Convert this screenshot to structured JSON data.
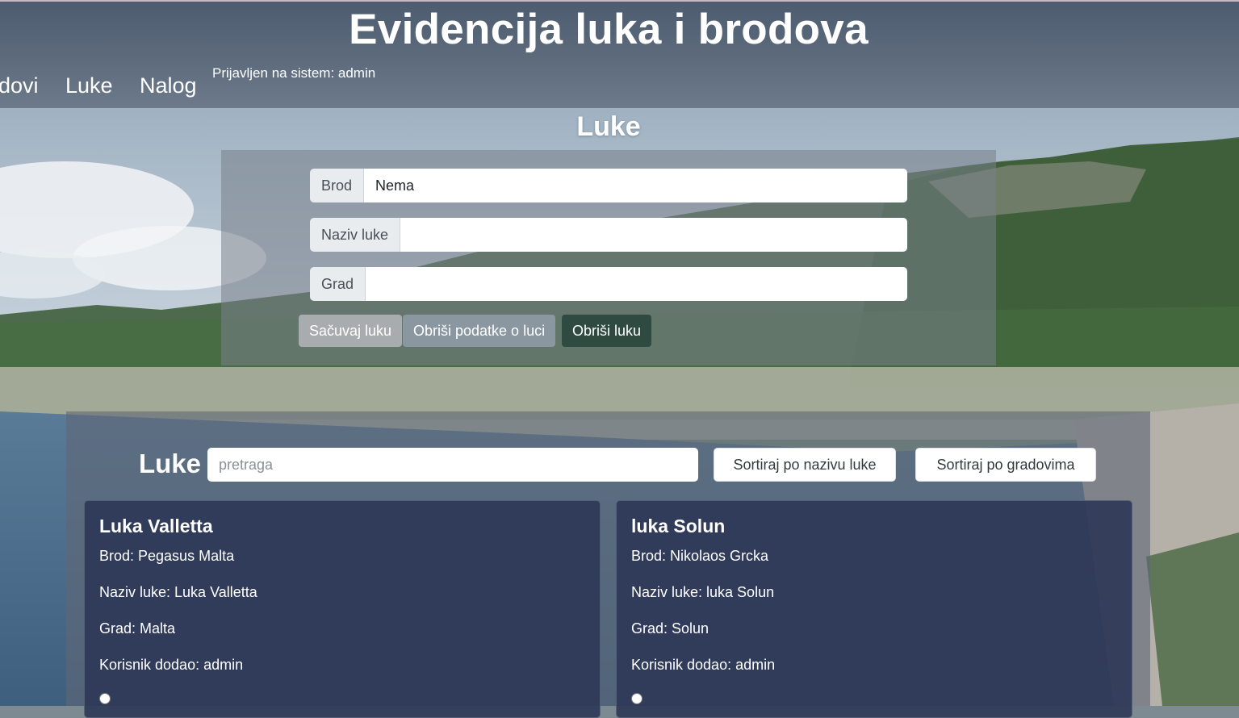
{
  "header": {
    "title": "Evidencija luka i brodova",
    "nav": [
      "dovi",
      "Luke",
      "Nalog"
    ],
    "login_status": "Prijavljen na sistem: admin"
  },
  "form": {
    "section_title": "Luke",
    "fields": [
      {
        "label": "Brod",
        "value": "Nema"
      },
      {
        "label": "Naziv luke",
        "value": ""
      },
      {
        "label": "Grad",
        "value": ""
      }
    ],
    "buttons": {
      "save": "Sačuvaj luku",
      "clear": "Obriši podatke o luci",
      "delete": "Obriši luku"
    }
  },
  "list": {
    "title": "Luke",
    "search_placeholder": "pretraga",
    "sort_by_name": "Sortiraj po nazivu luke",
    "sort_by_city": "Sortiraj po gradovima",
    "cards": [
      {
        "title": "Luka Valletta",
        "ship": "Brod: Pegasus Malta",
        "port_name": "Naziv luke: Luka Valletta",
        "city": "Grad: Malta",
        "added_by": "Korisnik dodao: admin"
      },
      {
        "title": "luka Solun",
        "ship": "Brod: Nikolaos Grcka",
        "port_name": "Naziv luke: luka Solun",
        "city": "Grad: Solun",
        "added_by": "Korisnik dodao: admin"
      }
    ]
  },
  "colors": {
    "header_bg": "#5d6b7d",
    "btn_save": "#a9acae",
    "btn_clear": "#8a97a1",
    "btn_delete": "#2f4a41",
    "card_bg": "#2c3757"
  }
}
